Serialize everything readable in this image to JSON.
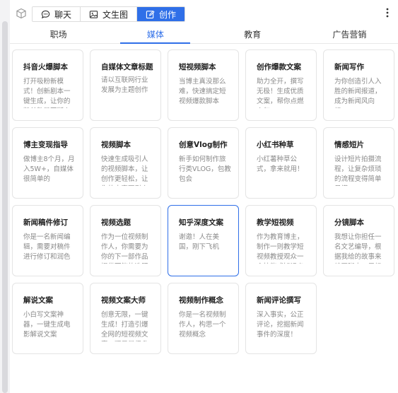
{
  "toolbar": {
    "modes": [
      {
        "label": "聊天",
        "icon": "chat-icon",
        "active": false
      },
      {
        "label": "文生图",
        "icon": "image-icon",
        "active": false
      },
      {
        "label": "创作",
        "icon": "edit-icon",
        "active": true
      }
    ],
    "accent_color": "#2f6fe8"
  },
  "tabs": [
    {
      "label": "职场",
      "active": false
    },
    {
      "label": "媒体",
      "active": true
    },
    {
      "label": "教育",
      "active": false
    },
    {
      "label": "广告营销",
      "active": false
    }
  ],
  "cards": [
    {
      "title": "抖音火爆脚本",
      "desc": "打开吸粉新模式！创新剧本一键生成，让你的粉丝数量不断上升"
    },
    {
      "title": "自媒体文章标题",
      "desc": "请以互联网行业发展为主题创作一个自媒体文章标题"
    },
    {
      "title": "短视频脚本",
      "desc": "当博主真没那么难，快速搞定短视频爆款脚本"
    },
    {
      "title": "创作爆款文案",
      "desc": "助力全开，撰写无极！生成优质文案，帮你点燃人气"
    },
    {
      "title": "新闻写作",
      "desc": "为你创造引人入胜的新闻报道，成为新闻风向标。"
    },
    {
      "title": "博主变现指导",
      "desc": "做博主8个月，月入5W+，自媒体很简单的"
    },
    {
      "title": "视频脚本",
      "desc": "快速生成吸引人的视频脚本，让创作更轻松，让你的内容更引人注目"
    },
    {
      "title": "创意Vlog制作",
      "desc": "新手如何制作旅行类VLOG，包教包会"
    },
    {
      "title": "小红书种草",
      "desc": "小红薯种草公式，拿来就用！"
    },
    {
      "title": "情感短片",
      "desc": "设计短片拍摄流程，让复杂烦琐的流程变得简单易懂。"
    },
    {
      "title": "新闻稿件修订",
      "desc": "你是一名新闻编辑，需要对稿件进行修订和润色"
    },
    {
      "title": "视频选题",
      "desc": "作为一位视频制作人，你需要为你的下一部作品提供可能的选题"
    },
    {
      "title": "知乎深度文案",
      "desc": "谢邀！人在美国，刚下飞机"
    },
    {
      "title": "教学短视频",
      "desc": "作为教育博主，制作一则教学短视频教授观众一个技能或知识点"
    },
    {
      "title": "分镜脚本",
      "desc": "我想让你担任一名文艺编导，根据我给的故事来编写脚本，用标准"
    },
    {
      "title": "解说文案",
      "desc": "小白写文案神器，一键生成电影解说文案"
    },
    {
      "title": "视频文案大师",
      "desc": "创意无限，一键生成！打造引爆全网的短视频文案，观看量飙升"
    },
    {
      "title": "视频制作概念",
      "desc": "你是一名视频制作人，构思一个视频概念"
    },
    {
      "title": "新闻评论撰写",
      "desc": "深入事实，公正评论，挖掘新闻事件的深度！"
    }
  ]
}
